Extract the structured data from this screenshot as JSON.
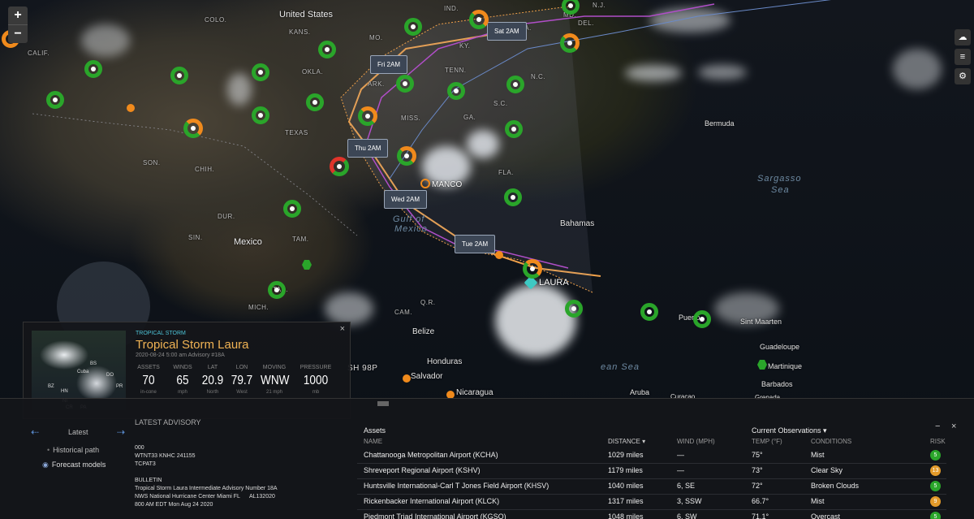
{
  "map": {
    "zoom_in": "+",
    "zoom_out": "−",
    "country_labels": [
      "United States",
      "Mexico",
      "Bahamas",
      "Bermuda"
    ],
    "ocean_labels": [
      "Sargasso",
      "Sea",
      "Gulf of",
      "Mexico",
      "ean Sea"
    ],
    "places": [
      "COLO.",
      "KANS.",
      "MO.",
      "IND.",
      "OKLA.",
      "ARK.",
      "TENN.",
      "TEXAS",
      "MISS.",
      "N.C.",
      "S.C.",
      "FLA.",
      "SON.",
      "CHIH.",
      "CALIF.",
      "SIN.",
      "DUR.",
      "TAM.",
      "MICH.",
      "CAM.",
      "Belize",
      "Honduras",
      "Salvador",
      "Nicaragua",
      "Aruba",
      "Curaçao",
      "Puerto",
      "Sint Maarten",
      "Guadeloupe",
      "Martinique",
      "Barbados",
      "Grenada",
      "MD.",
      "DEL.",
      "VA.",
      "KY.",
      "GA.",
      "N.J.",
      "Q.R.",
      "TAB.",
      "MANCO",
      "LAURA",
      "SH 98P"
    ],
    "forecast_points": [
      "Sat 2AM",
      "Fri 2AM",
      "Thu 2AM",
      "Wed 2AM",
      "Tue 2AM"
    ],
    "storm_markers": [
      "MANCO",
      "LAURA"
    ],
    "colors": {
      "green": "#2aa52a",
      "orange": "#f08a1c",
      "red": "#e0342a",
      "track": "#f0a14a",
      "model": "#b04ec8"
    }
  },
  "storm_card": {
    "type": "TROPICAL STORM",
    "name": "Tropical Storm Laura",
    "date": "2020-08-24 5:00 am Advisory #18A",
    "thumbnail_labels": [
      "BS",
      "DO",
      "Cuba",
      "HN",
      "NI",
      "CR",
      "PA",
      "PR",
      "BZ"
    ],
    "stats": [
      {
        "label": "ASSETS",
        "value": "70",
        "sub": "in-cone"
      },
      {
        "label": "WINDS",
        "value": "65",
        "sub": "mph"
      },
      {
        "label": "LAT",
        "value": "20.9",
        "sub": "North"
      },
      {
        "label": "LON",
        "value": "79.7",
        "sub": "West"
      },
      {
        "label": "MOVING",
        "value": "WNW",
        "sub": "21 mph"
      },
      {
        "label": "PRESSURE",
        "value": "1000",
        "sub": "mb"
      }
    ],
    "close": "×"
  },
  "bottom_panel": {
    "nav_label": "Latest",
    "historical": "Historical path",
    "forecast": "Forecast models",
    "advisory_title": "LATEST ADVISORY",
    "advisory_text": "000\nWTNT33 KNHC 241155\nTCPAT3\n\nBULLETIN\nTropical Storm Laura Intermediate Advisory Number 18A\nNWS National Hurricane Center Miami FL      AL132020\n800 AM EDT Mon Aug 24 2020",
    "assets_title": "Assets",
    "current_obs": "Current Observations ▾",
    "minimize": "−",
    "close": "×",
    "columns": [
      "NAME",
      "DISTANCE ▾",
      "WIND (mph)",
      "TEMP (°F)",
      "CONDITIONS",
      "RISK"
    ],
    "rows": [
      {
        "name": "Chattanooga Metropolitan Airport (KCHA)",
        "distance": "1029 miles",
        "wind": "—",
        "temp": "75°",
        "conditions": "Mist",
        "risk": "5",
        "risk_color": "#2aa52a"
      },
      {
        "name": "Shreveport Regional Airport (KSHV)",
        "distance": "1179 miles",
        "wind": "—",
        "temp": "73°",
        "conditions": "Clear Sky",
        "risk": "13",
        "risk_color": "#e39a2a"
      },
      {
        "name": "Huntsville International-Carl T Jones Field Airport (KHSV)",
        "distance": "1040 miles",
        "wind": "6, SE",
        "temp": "72°",
        "conditions": "Broken Clouds",
        "risk": "5",
        "risk_color": "#2aa52a"
      },
      {
        "name": "Rickenbacker International Airport (KLCK)",
        "distance": "1317 miles",
        "wind": "3, SSW",
        "temp": "66.7°",
        "conditions": "Mist",
        "risk": "9",
        "risk_color": "#e39a2a"
      },
      {
        "name": "Piedmont Triad International Airport (KGSO)",
        "distance": "1048 miles",
        "wind": "6, SW",
        "temp": "71.1°",
        "conditions": "Overcast",
        "risk": "5",
        "risk_color": "#2aa52a"
      }
    ]
  }
}
